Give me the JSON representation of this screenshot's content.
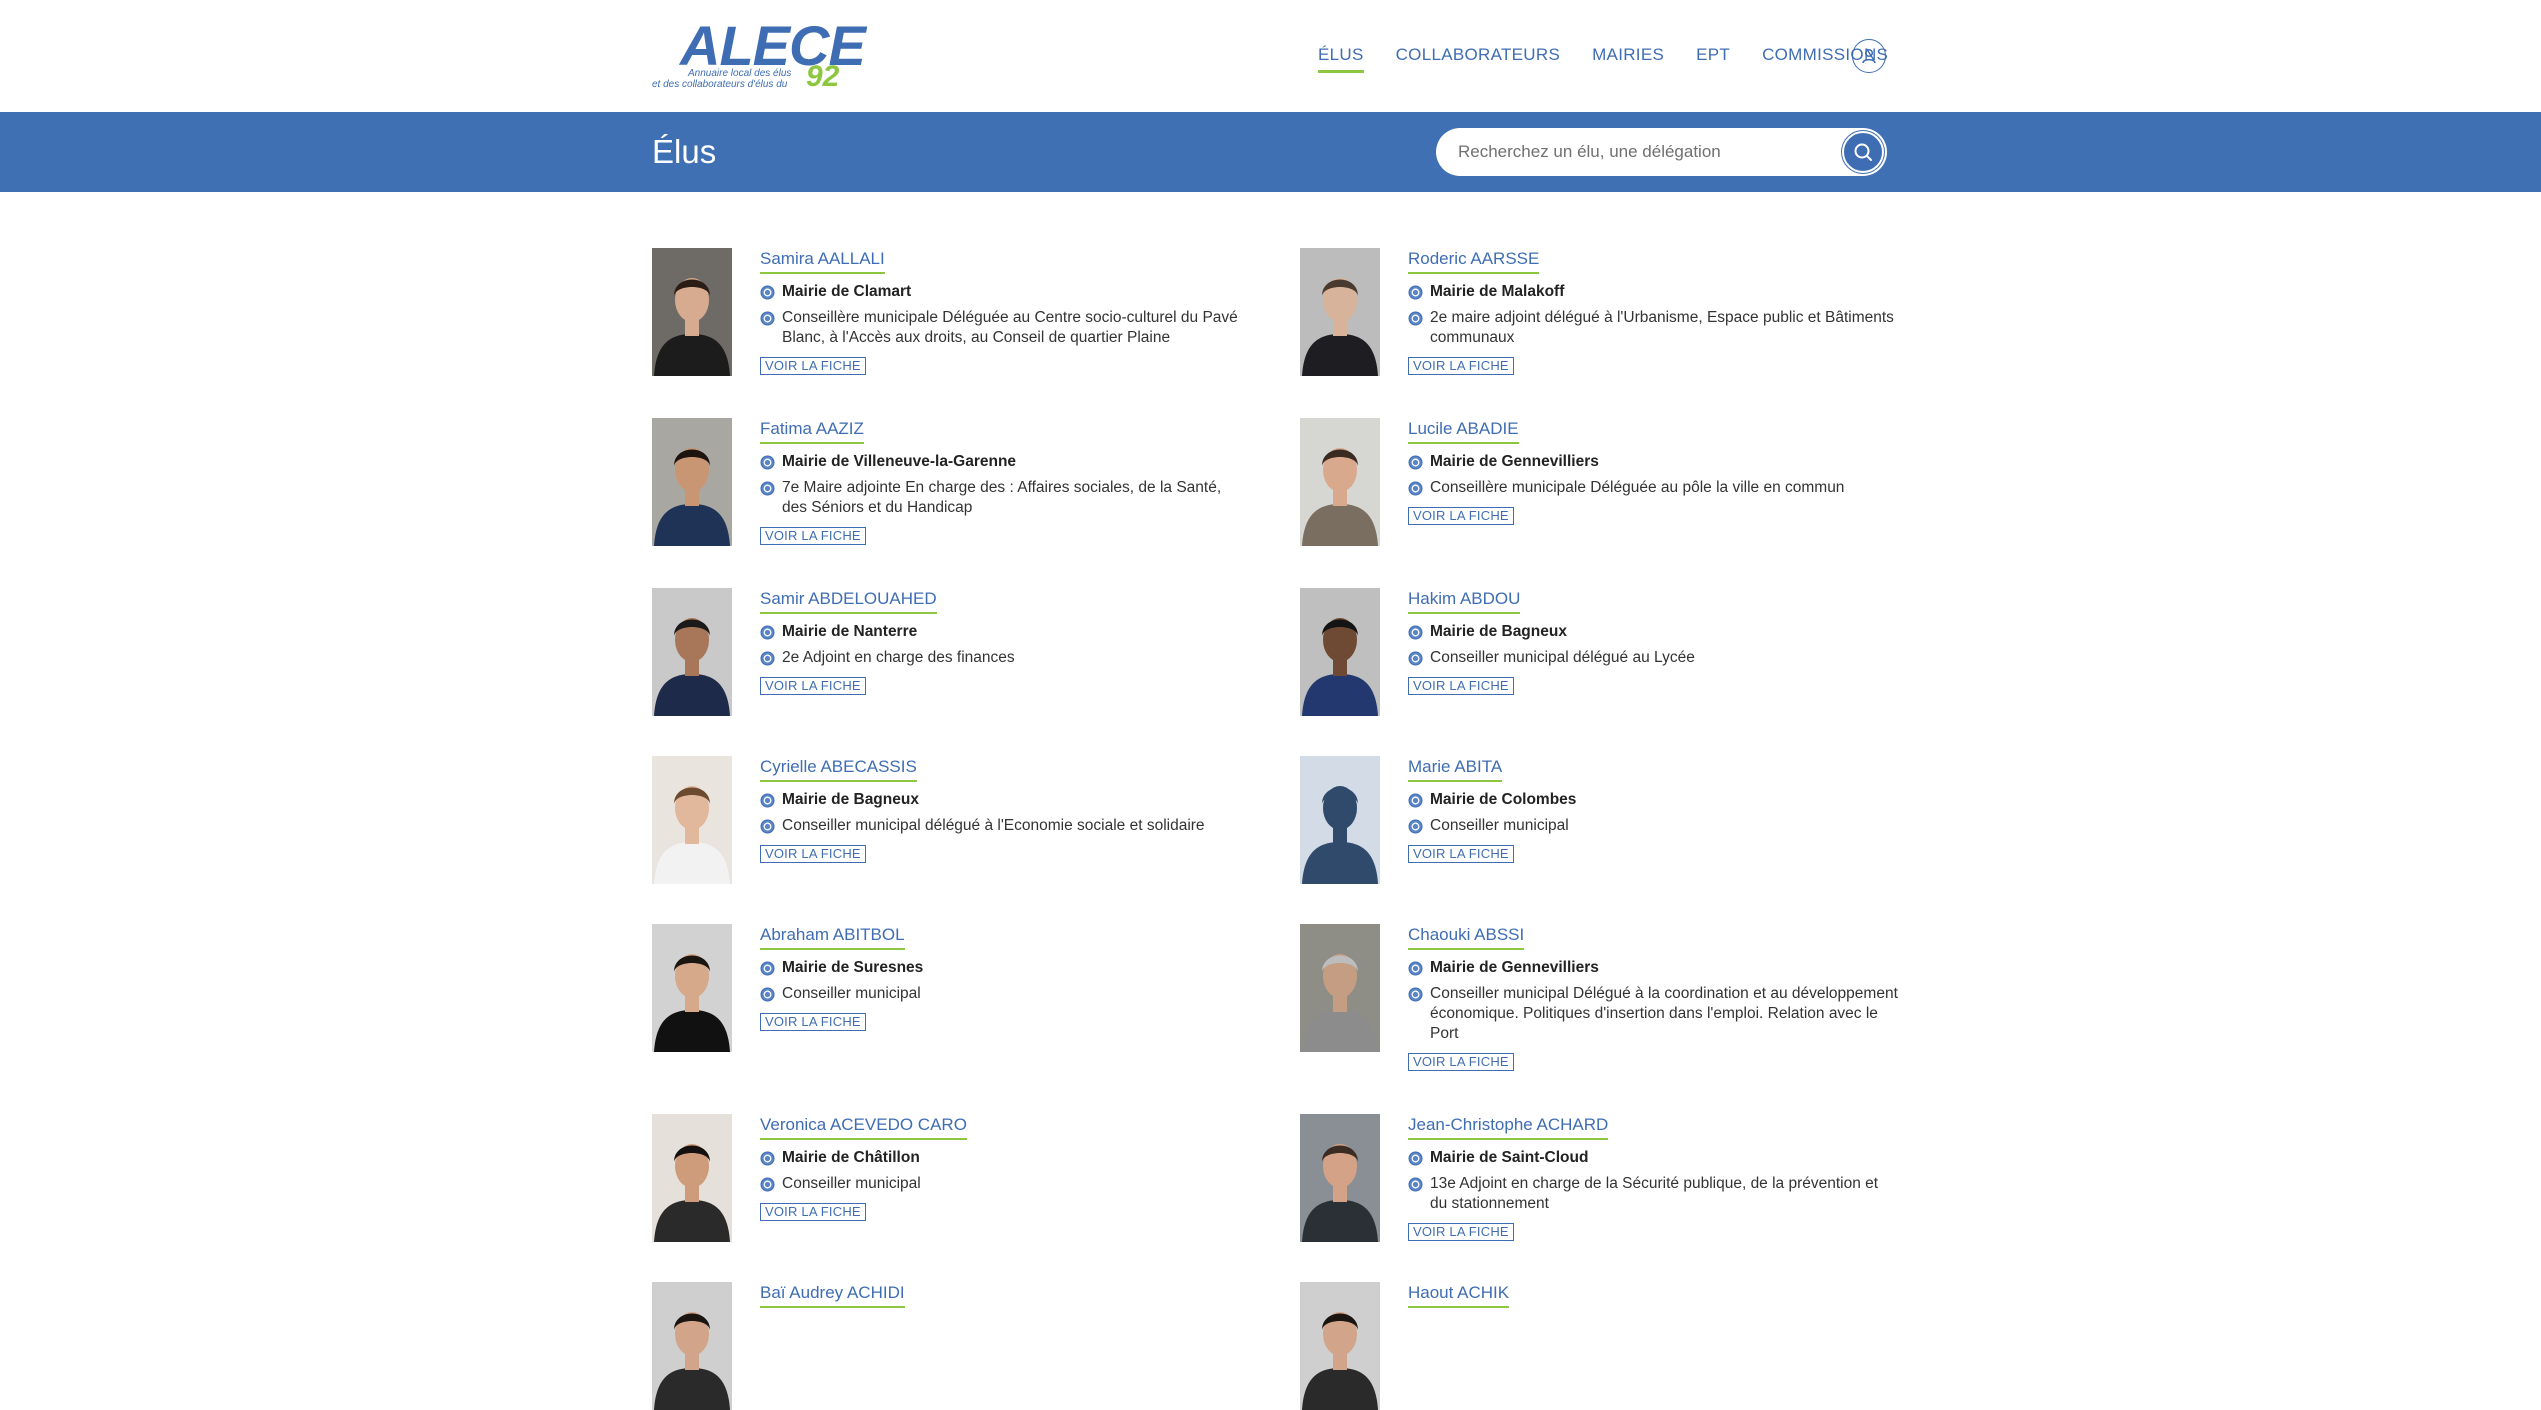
{
  "logo": {
    "text": "ALECE",
    "tagline_1": "Annuaire local des élus",
    "tagline_2": "et des collaborateurs d'élus du",
    "number": "92"
  },
  "nav": {
    "items": [
      {
        "label": "ÉLUS",
        "active": true
      },
      {
        "label": "COLLABORATEURS",
        "active": false
      },
      {
        "label": "MAIRIES",
        "active": false
      },
      {
        "label": "EPT",
        "active": false
      },
      {
        "label": "COMMISSIONS",
        "active": false
      }
    ],
    "user_icon": "user-icon"
  },
  "band": {
    "title": "Élus",
    "search_placeholder": "Recherchez un élu, une délégation",
    "search_icon": "search-icon"
  },
  "colors": {
    "primary": "#4070b4",
    "accent": "#8dc63f",
    "text": "#2b2b2b"
  },
  "fiche_label": "VOIR LA FICHE",
  "elus": [
    {
      "name": "Samira AALLALI",
      "mairie": "Mairie de Clamart",
      "role": "Conseillère municipale Déléguée au Centre socio-culturel du Pavé Blanc, à l'Accès aux droits, au Conseil de quartier Plaine"
    },
    {
      "name": "Roderic AARSSE",
      "mairie": "Mairie de Malakoff",
      "role": "2e maire adjoint délégué à l'Urbanisme, Espace public et Bâtiments communaux"
    },
    {
      "name": "Fatima AAZIZ",
      "mairie": "Mairie de Villeneuve-la-Garenne",
      "role": "7e Maire adjointe En charge des : Affaires sociales, de la Santé, des Séniors et du Handicap"
    },
    {
      "name": "Lucile ABADIE",
      "mairie": "Mairie de Gennevilliers",
      "role": "Conseillère municipale Déléguée au pôle la ville en commun"
    },
    {
      "name": "Samir ABDELOUAHED",
      "mairie": "Mairie de Nanterre",
      "role": "2e Adjoint en charge des finances"
    },
    {
      "name": "Hakim ABDOU",
      "mairie": "Mairie de Bagneux",
      "role": "Conseiller municipal délégué au Lycée"
    },
    {
      "name": "Cyrielle ABECASSIS",
      "mairie": "Mairie de Bagneux",
      "role": "Conseiller municipal délégué à l'Economie sociale et solidaire"
    },
    {
      "name": "Marie ABITA",
      "mairie": "Mairie de Colombes",
      "role": "Conseiller municipal"
    },
    {
      "name": "Abraham ABITBOL",
      "mairie": "Mairie de Suresnes",
      "role": "Conseiller municipal"
    },
    {
      "name": "Chaouki ABSSI",
      "mairie": "Mairie de Gennevilliers",
      "role": "Conseiller municipal Délégué à la coordination et au développement économique. Politiques d'insertion dans l'emploi. Relation avec le Port"
    },
    {
      "name": "Veronica ACEVEDO CARO",
      "mairie": "Mairie de Châtillon",
      "role": "Conseiller municipal"
    },
    {
      "name": "Jean-Christophe ACHARD",
      "mairie": "Mairie de Saint-Cloud",
      "role": "13e Adjoint en charge de la Sécurité publique, de la prévention et du stationnement"
    },
    {
      "name": "Baï Audrey ACHIDI",
      "mairie": "",
      "role": ""
    },
    {
      "name": "Haout ACHIK",
      "mairie": "",
      "role": ""
    }
  ]
}
